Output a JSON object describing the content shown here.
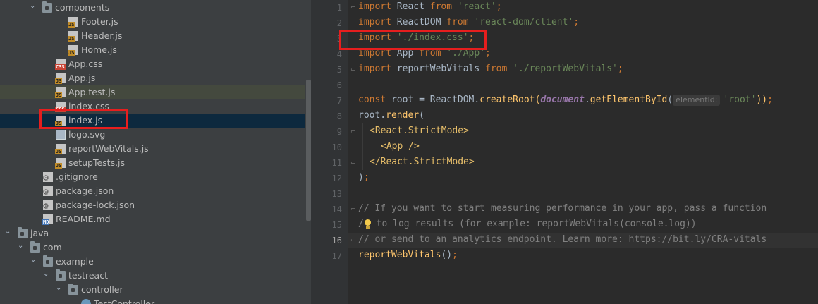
{
  "tree": {
    "rows": [
      {
        "label": "components",
        "icon": "folder-icon",
        "type": "folder",
        "expanded": true
      },
      {
        "label": "Footer.js",
        "icon": "js-file-icon",
        "type": "js"
      },
      {
        "label": "Header.js",
        "icon": "js-file-icon",
        "type": "js"
      },
      {
        "label": "Home.js",
        "icon": "js-file-icon",
        "type": "js"
      },
      {
        "label": "App.css",
        "icon": "css-file-icon",
        "type": "css"
      },
      {
        "label": "App.js",
        "icon": "js-file-icon",
        "type": "js"
      },
      {
        "label": "App.test.js",
        "icon": "js-file-icon",
        "type": "js"
      },
      {
        "label": "index.css",
        "icon": "css-file-icon",
        "type": "css"
      },
      {
        "label": "index.js",
        "icon": "js-file-icon",
        "type": "js"
      },
      {
        "label": "logo.svg",
        "icon": "svg-file-icon",
        "type": "svg"
      },
      {
        "label": "reportWebVitals.js",
        "icon": "js-file-icon",
        "type": "js"
      },
      {
        "label": "setupTests.js",
        "icon": "js-file-icon",
        "type": "js"
      },
      {
        "label": ".gitignore",
        "icon": "gitignore-file-icon",
        "type": "gear"
      },
      {
        "label": "package.json",
        "icon": "json-file-icon",
        "type": "gear"
      },
      {
        "label": "package-lock.json",
        "icon": "json-file-icon",
        "type": "gear"
      },
      {
        "label": "README.md",
        "icon": "markdown-file-icon",
        "type": "md"
      },
      {
        "label": "java",
        "icon": "folder-icon",
        "type": "folder",
        "expanded": true
      },
      {
        "label": "com",
        "icon": "folder-icon",
        "type": "folder",
        "expanded": true
      },
      {
        "label": "example",
        "icon": "folder-icon",
        "type": "folder",
        "expanded": true
      },
      {
        "label": "testreact",
        "icon": "folder-icon",
        "type": "folder",
        "expanded": true
      },
      {
        "label": "controller",
        "icon": "folder-icon",
        "type": "folder",
        "expanded": true
      },
      {
        "label": "TestController",
        "icon": "class-file-icon",
        "type": "class"
      }
    ]
  },
  "editor": {
    "line_numbers": [
      "1",
      "2",
      "3",
      "4",
      "5",
      "6",
      "7",
      "8",
      "9",
      "10",
      "11",
      "12",
      "13",
      "14",
      "15",
      "16",
      "17"
    ],
    "current_line": "16",
    "code": {
      "l1": {
        "kw": "import",
        "name": " React ",
        "from": "from",
        "str": " 'react'",
        "semi": ";"
      },
      "l2": {
        "kw": "import",
        "name": " ReactDOM ",
        "from": "from",
        "str": " 'react-dom/client'",
        "semi": ";"
      },
      "l3": {
        "kw": "import",
        "str": " './index.css'",
        "semi": ";"
      },
      "l4": {
        "kw": "import",
        "name": " App ",
        "from": "from",
        "str": " './App'",
        "semi": ";"
      },
      "l5": {
        "kw": "import",
        "name": " reportWebVitals ",
        "from": "from",
        "str": " './reportWebVitals'",
        "semi": ";"
      },
      "l7": {
        "kw": "const",
        "a": " root = ReactDOM.",
        "fn": "createRoot",
        "b": "(",
        "glob": "document",
        "c": ".",
        "fn2": "getElementById",
        "d": "(",
        "hint": "elementId:",
        "str": "'root'",
        "e": "))",
        "semi": ";"
      },
      "l8": {
        "a": "root.",
        "fn": "render",
        "b": "("
      },
      "l9": {
        "open": "<",
        "tag": "React.StrictMode",
        "close": ">"
      },
      "l10": {
        "open": "<",
        "tag": "App",
        "close": " />"
      },
      "l11": {
        "open": "</",
        "tag": "React.StrictMode",
        "close": ">"
      },
      "l12": {
        "a": ")",
        "semi": ";"
      },
      "l14": {
        "com": "// If you want to start measuring performance in your app, pass a function"
      },
      "l15": {
        "pre": "/",
        "com": " to log results (for example: reportWebVitals(console.log))"
      },
      "l16": {
        "com": "// or send to an analytics endpoint. Learn more: ",
        "link": "https://bit.ly/CRA-vitals"
      },
      "l17": {
        "fn": "reportWebVitals",
        "a": "()",
        "semi": ";"
      }
    }
  },
  "colors": {
    "tree_bg": "#3c3f41",
    "editor_bg": "#2b2b2b",
    "selection": "#0d293e",
    "highlight_red": "#e61e1e",
    "keyword": "#cc7832",
    "string": "#6a8759"
  }
}
